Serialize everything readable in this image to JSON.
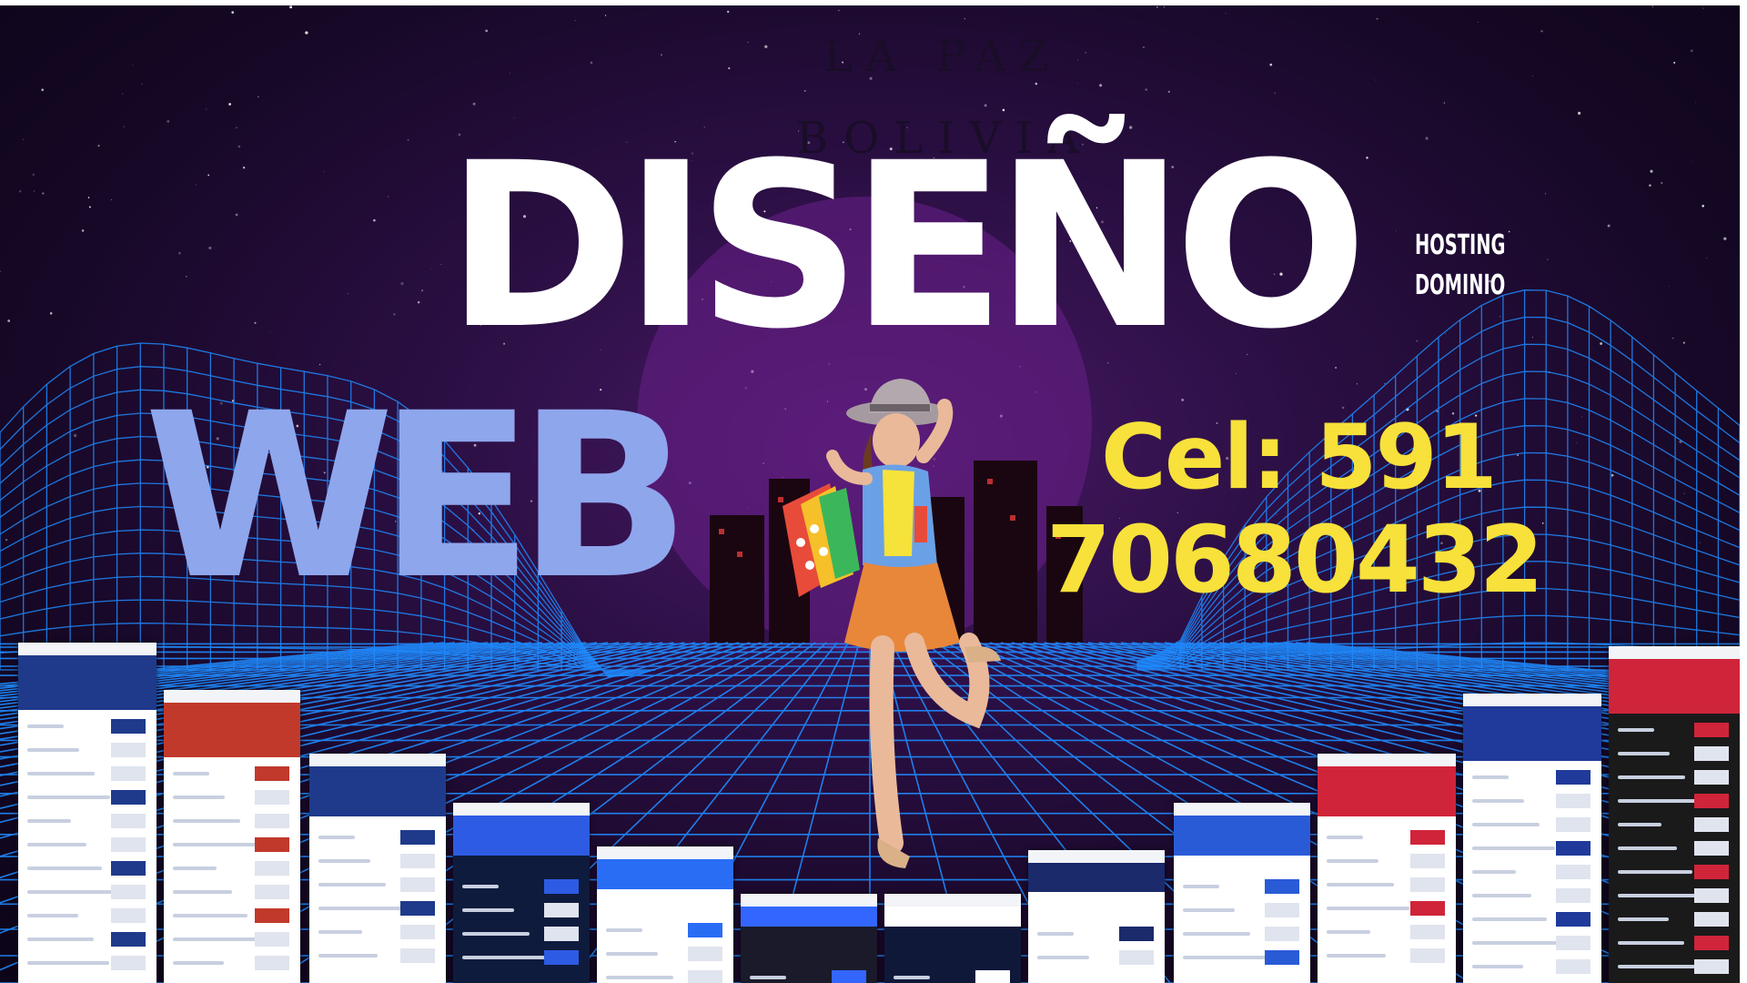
{
  "location": {
    "city": "LA PAZ",
    "country": "BOLIVIA"
  },
  "headline": {
    "line1": "DISEÑO",
    "line2": "WEB"
  },
  "services": [
    "HOSTING",
    "DOMINIO"
  ],
  "contact": {
    "line1": "Cel: 591",
    "line2": "70680432"
  },
  "colors": {
    "headline_line1": "#ffffff",
    "headline_line2": "#8ea6ec",
    "contact": "#f7e13a",
    "grid": "#1f8bff",
    "background": "#1a0a2e"
  },
  "decorations": [
    "website-mockup-thumbnails",
    "shopping-woman-photo",
    "neon-grid-landscape",
    "starfield",
    "city-skyline"
  ]
}
